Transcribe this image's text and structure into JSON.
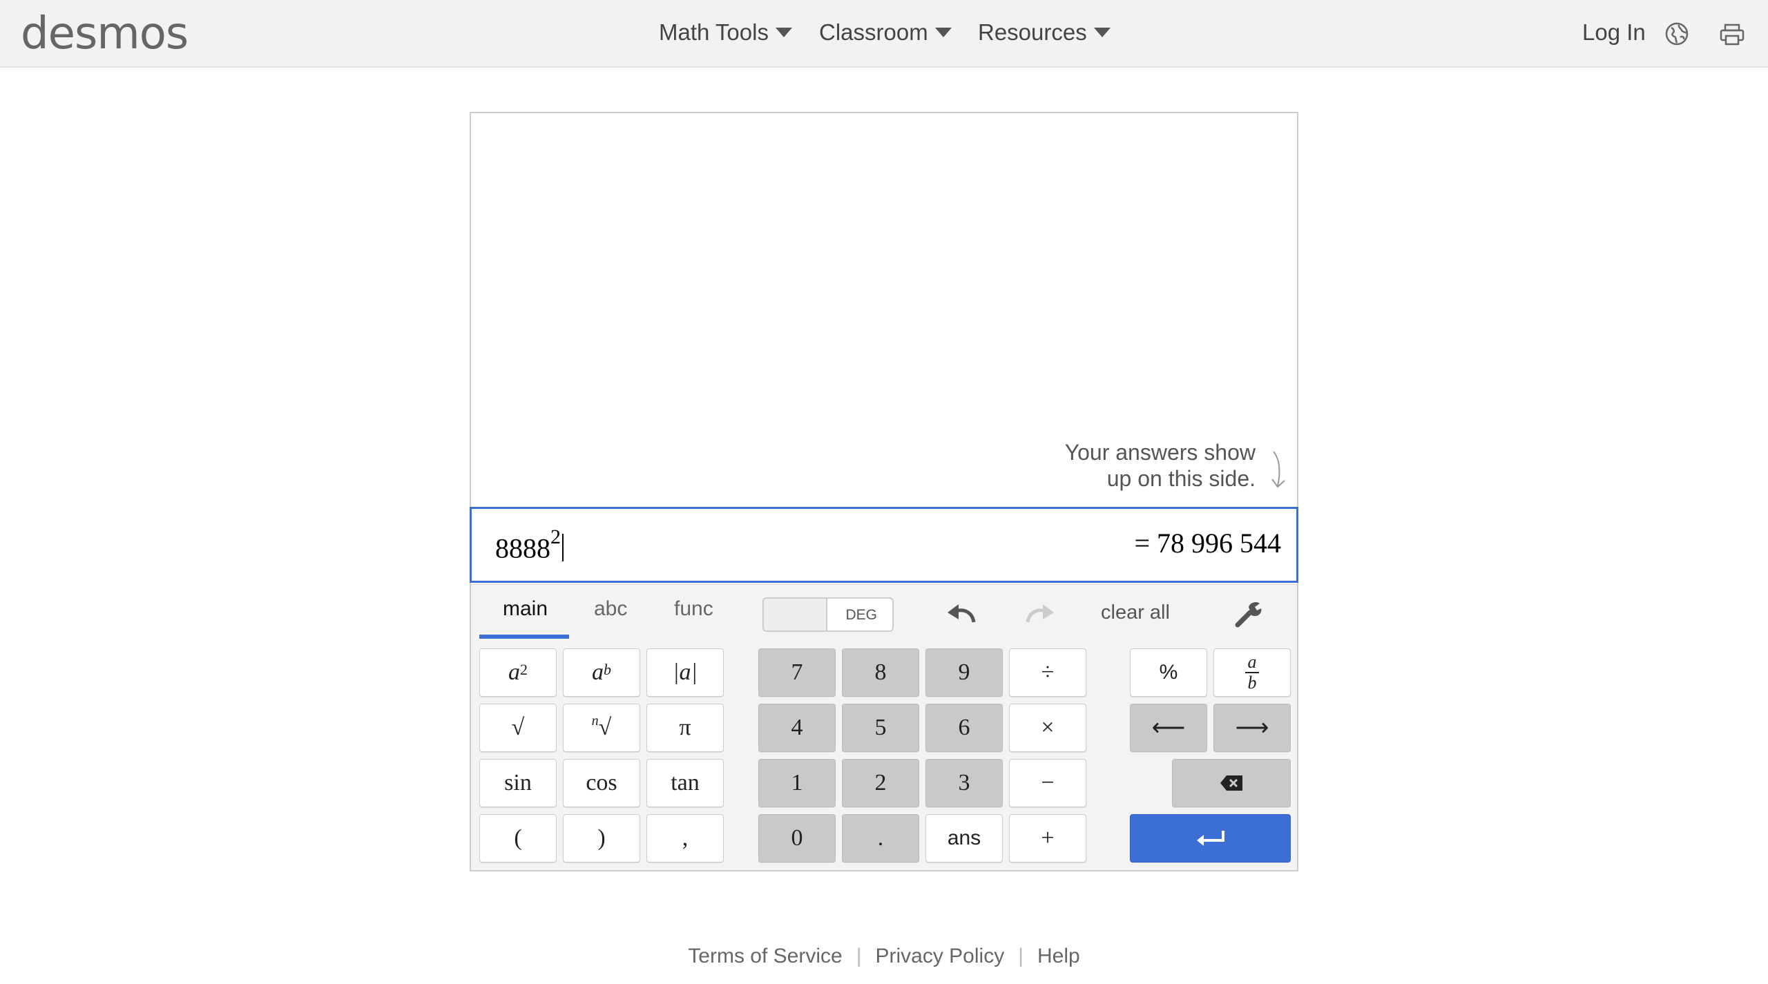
{
  "header": {
    "logo": "desmos",
    "nav": [
      {
        "label": "Math Tools"
      },
      {
        "label": "Classroom"
      },
      {
        "label": "Resources"
      }
    ],
    "login": "Log In",
    "icons": {
      "language": "globe-icon",
      "print": "printer-icon"
    }
  },
  "calculator": {
    "hint_line1": "Your answers show",
    "hint_line2": "up on this side.",
    "expression": {
      "base": "8888",
      "exponent": "2"
    },
    "result": "= 78 996 544",
    "tabs": [
      "main",
      "abc",
      "func"
    ],
    "active_tab": "main",
    "angle_mode": "DEG",
    "clear_all": "clear all",
    "keys": {
      "sin": "sin",
      "cos": "cos",
      "tan": "tan",
      "pi": "π",
      "abs": "|a|",
      "sqrt": "√",
      "nroot_index": "n",
      "lparen": "(",
      "rparen": ")",
      "comma": ",",
      "n7": "7",
      "n8": "8",
      "n9": "9",
      "div": "÷",
      "n4": "4",
      "n5": "5",
      "n6": "6",
      "mul": "×",
      "n1": "1",
      "n2": "2",
      "n3": "3",
      "sub": "−",
      "n0": "0",
      "dot": ".",
      "ans": "ans",
      "add": "+",
      "percent": "%",
      "left": "⟵",
      "right": "⟶",
      "a": "a",
      "b": "b",
      "sq_exp": "2"
    }
  },
  "footer": {
    "terms": "Terms of Service",
    "privacy": "Privacy Policy",
    "help": "Help",
    "separator": "|"
  },
  "colors": {
    "accent": "#3b6fd6",
    "gray_key": "#c9c9c9",
    "header_bg": "#f2f2f2"
  }
}
